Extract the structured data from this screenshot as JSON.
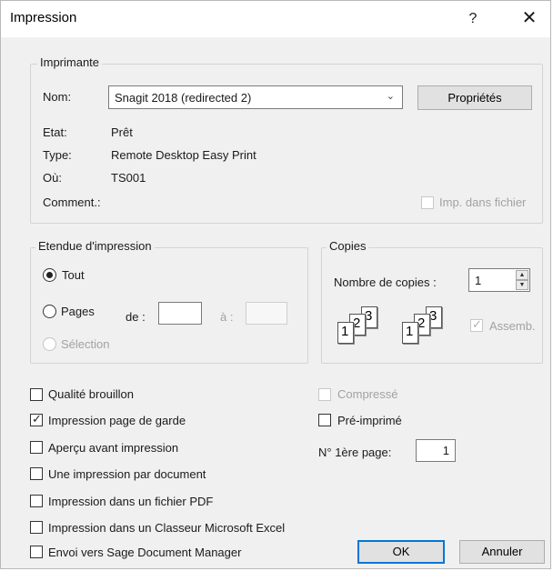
{
  "window": {
    "title": "Impression",
    "help_label": "?",
    "close_label": "✕"
  },
  "printer": {
    "legend": "Imprimante",
    "name_label": "Nom:",
    "name_value": "Snagit 2018 (redirected 2)",
    "properties_label": "Propriétés",
    "state_label": "Etat:",
    "state_value": "Prêt",
    "type_label": "Type:",
    "type_value": "Remote Desktop Easy Print",
    "where_label": "Où:",
    "where_value": "TS001",
    "comment_label": "Comment.:",
    "print_to_file_label": "Imp. dans fichier"
  },
  "range": {
    "legend": "Etendue d'impression",
    "all_label": "Tout",
    "pages_label": "Pages",
    "from_label": "de :",
    "to_label": "à :",
    "selection_label": "Sélection"
  },
  "copies": {
    "legend": "Copies",
    "count_label": "Nombre de copies :",
    "count_value": "1",
    "collate_label": "Assemb."
  },
  "options": {
    "draft_quality": "Qualité brouillon",
    "cover_page": "Impression page de garde",
    "preview": "Aperçu avant impression",
    "one_per_doc": "Une impression par document",
    "to_pdf": "Impression dans un fichier PDF",
    "to_excel": "Impression dans un Classeur Microsoft Excel",
    "to_sage": "Envoi vers Sage Document Manager",
    "compressed": "Compressé",
    "preprinted": "Pré-imprimé",
    "first_page_label": "N° 1ère page:",
    "first_page_value": "1"
  },
  "buttons": {
    "ok": "OK",
    "cancel": "Annuler"
  }
}
